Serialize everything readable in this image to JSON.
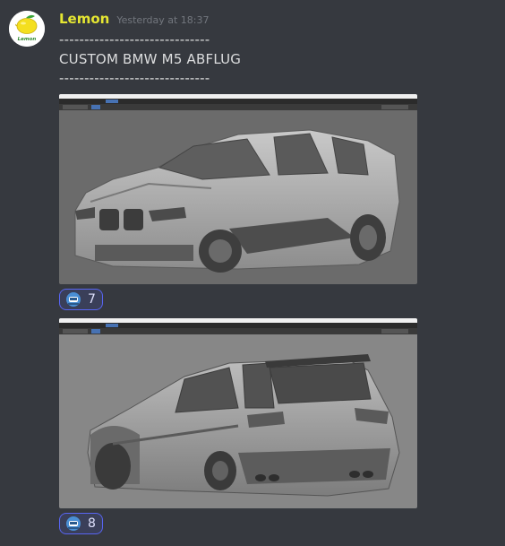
{
  "message": {
    "author": {
      "name": "Lemon",
      "name_color": "#e5e632",
      "avatar_icon": "lemon-icon",
      "avatar_badge": "Lemon"
    },
    "timestamp": "Yesterday at 18:37",
    "lines": [
      "------------------------------",
      "CUSTOM BMW M5 ABFLUG",
      "------------------------------"
    ]
  },
  "attachments": [
    {
      "kind": "screenshot",
      "subject": "BMW M5 Touring widebody model in 3D editor (front-left view)",
      "viewport_bg": "#6b6b6b",
      "reaction": {
        "emoji_icon": "helmet-emoji-icon",
        "count": "7"
      }
    },
    {
      "kind": "screenshot",
      "subject": "BMW M5 Touring widebody model in 3D editor (rear-left view)",
      "viewport_bg": "#878787",
      "reaction": {
        "emoji_icon": "helmet-emoji-icon",
        "count": "8"
      }
    }
  ],
  "colors": {
    "background": "#36393f",
    "text": "#dcddde",
    "muted": "#72767d",
    "reaction_border": "#5865f2"
  }
}
